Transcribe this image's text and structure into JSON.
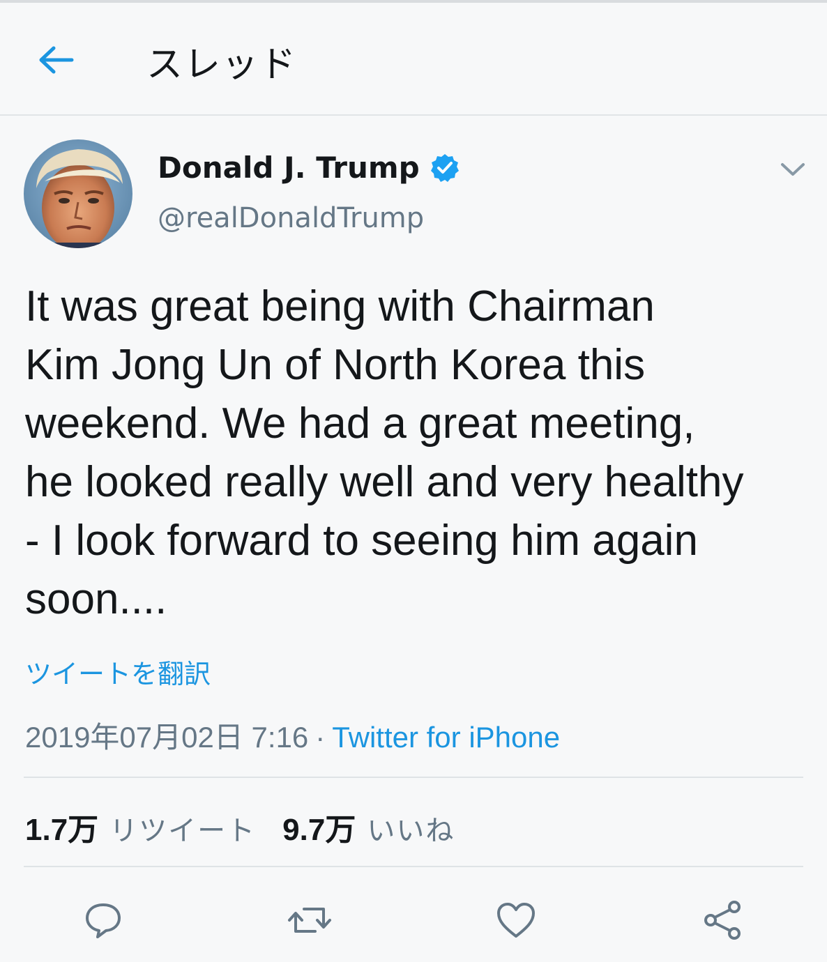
{
  "header": {
    "title": "スレッド",
    "back_icon": "back-arrow-icon"
  },
  "tweet": {
    "display_name": "Donald J. Trump",
    "handle": "@realDonaldTrump",
    "verified": true,
    "text": "It was great being with Chairman\nKim Jong Un of North Korea this\nweekend. We had a great meeting,\nhe looked really well and very healthy\n- I look forward to seeing him again\nsoon....",
    "translate_label": "ツイートを翻訳",
    "timestamp": "2019年07月02日 7:16",
    "separator": "·",
    "source": "Twitter for iPhone",
    "retweets": {
      "count": "1.7万",
      "label": "リツイート"
    },
    "likes": {
      "count": "9.7万",
      "label": "いいね"
    }
  },
  "colors": {
    "accent": "#1b95e0",
    "text": "#14171a",
    "muted": "#657786",
    "background": "#f7f8f9",
    "divider": "#dfe3e6"
  },
  "icons": {
    "reply": "reply-icon",
    "retweet": "retweet-icon",
    "like": "heart-icon",
    "share": "share-icon",
    "more": "chevron-down-icon",
    "verified": "verified-badge-icon"
  }
}
